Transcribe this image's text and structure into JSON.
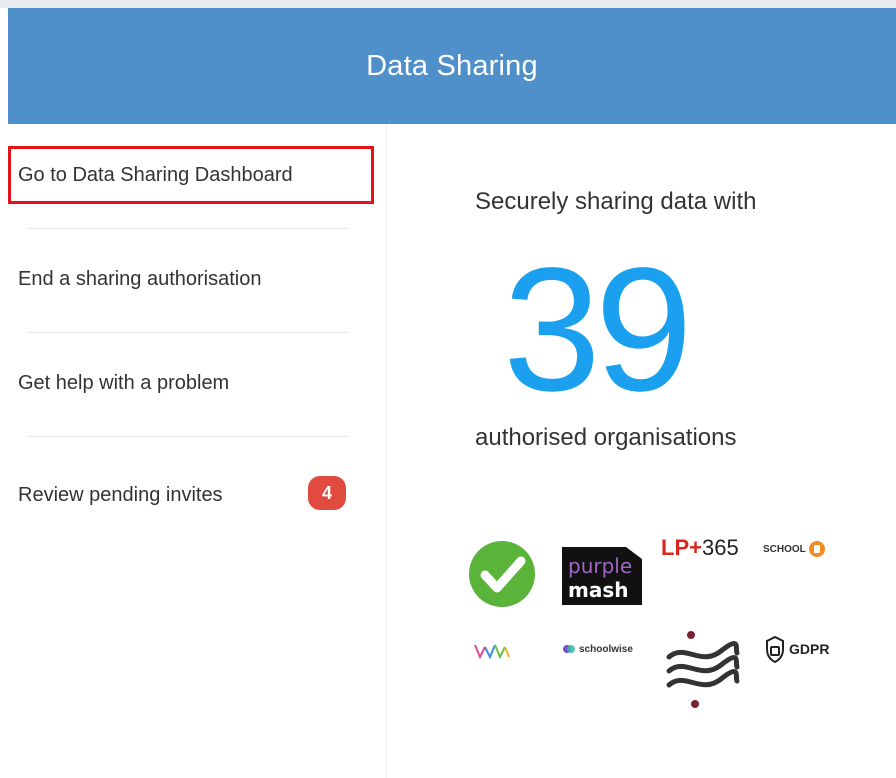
{
  "header": {
    "title": "Data Sharing"
  },
  "sidebar": {
    "items": [
      {
        "label": "Go to Data Sharing Dashboard"
      },
      {
        "label": "End a sharing authorisation"
      },
      {
        "label": "Get help with a problem"
      },
      {
        "label": "Review pending invites",
        "badge": "4"
      }
    ]
  },
  "main": {
    "lead_text": "Securely sharing data with",
    "count": "39",
    "tail_text": "authorised organisations"
  },
  "logos": {
    "lp365": {
      "prefix": "LP+",
      "suffix": "365"
    },
    "purple_mash": {
      "line1": "purple",
      "line2": "mash"
    },
    "school": "SCHOOL",
    "schoolwise": "schoolwise",
    "gdpr": "GDPR"
  },
  "colors": {
    "header_bg": "#4f8fca",
    "count": "#1aa0ee",
    "highlight_border": "#e3121b",
    "badge_bg": "#e04a3f"
  }
}
